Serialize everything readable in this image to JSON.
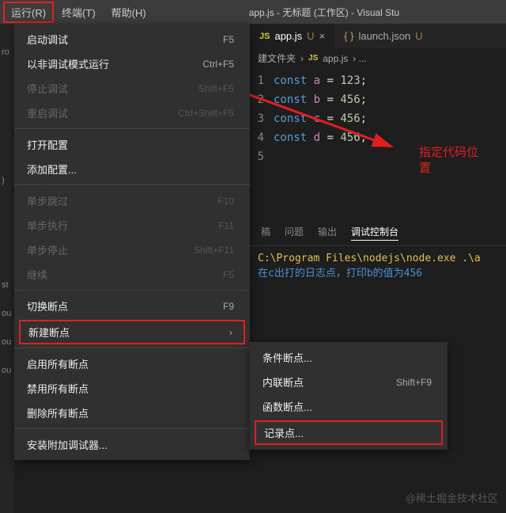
{
  "title_bar": {
    "menu": {
      "run": "运行(R)",
      "terminal": "终端(T)",
      "help": "帮助(H)"
    },
    "title": "app.js - 无标题 (工作区) - Visual Stu"
  },
  "left_strip": {
    "t0": "ro",
    "t1": ")",
    "t2": "st",
    "t3": "ou",
    "t4": "ou",
    "t5": "ou"
  },
  "run_menu": {
    "start_debug": {
      "label": "启动调试",
      "shortcut": "F5"
    },
    "run_no_debug": {
      "label": "以非调试模式运行",
      "shortcut": "Ctrl+F5"
    },
    "stop_debug": {
      "label": "停止调试",
      "shortcut": "Shift+F5"
    },
    "restart_debug": {
      "label": "重启调试",
      "shortcut": "Ctrl+Shift+F5"
    },
    "open_config": {
      "label": "打开配置",
      "shortcut": ""
    },
    "add_config": {
      "label": "添加配置...",
      "shortcut": ""
    },
    "step_over": {
      "label": "单步跳过",
      "shortcut": "F10"
    },
    "step_into": {
      "label": "单步执行",
      "shortcut": "F11"
    },
    "step_out": {
      "label": "单步停止",
      "shortcut": "Shift+F11"
    },
    "continue": {
      "label": "继续",
      "shortcut": "F5"
    },
    "toggle_bp": {
      "label": "切换断点",
      "shortcut": "F9"
    },
    "new_bp": {
      "label": "新建断点",
      "chevron": "›"
    },
    "enable_all": {
      "label": "启用所有断点"
    },
    "disable_all": {
      "label": "禁用所有断点"
    },
    "remove_all": {
      "label": "删除所有断点"
    },
    "install_debugger": {
      "label": "安装附加调试器..."
    }
  },
  "submenu": {
    "conditional": {
      "label": "条件断点..."
    },
    "inline": {
      "label": "内联断点",
      "shortcut": "Shift+F9"
    },
    "function": {
      "label": "函数断点..."
    },
    "logpoint": {
      "label": "记录点..."
    }
  },
  "tabs": {
    "app": {
      "icon": "JS",
      "name": "app.js",
      "modified": "U",
      "close": "×"
    },
    "launch": {
      "icon": "{ }",
      "name": "launch.json",
      "modified": "U"
    }
  },
  "breadcrumb": {
    "folder": "建文件夹",
    "icon": "JS",
    "file": "app.js",
    "more": "› ..."
  },
  "code": {
    "l1": {
      "no": "1",
      "kw": "const",
      "vn": "a",
      "eq": "=",
      "nm": "123",
      "sc": ";"
    },
    "l2": {
      "no": "2",
      "kw": "const",
      "vn": "b",
      "eq": "=",
      "nm": "456",
      "sc": ";"
    },
    "l3": {
      "no": "3",
      "kw": "const",
      "vn": "c",
      "eq": "=",
      "nm": "456",
      "sc": ";"
    },
    "l4": {
      "no": "4",
      "kw": "const",
      "vn": "d",
      "eq": "=",
      "nm": "456",
      "sc": ";"
    },
    "l5": {
      "no": "5"
    }
  },
  "annotation": {
    "line1": "指定代码位",
    "line2": "置"
  },
  "terminal": {
    "tabs": {
      "problems_cut": "稿",
      "problems": "问题",
      "output": "输出",
      "debug_console": "调试控制台"
    },
    "line1": "C:\\Program Files\\nodejs\\node.exe .\\a",
    "line2": "在c出打的日志点，打印b的值为456"
  },
  "watermark": "@稀土掘金技术社区"
}
